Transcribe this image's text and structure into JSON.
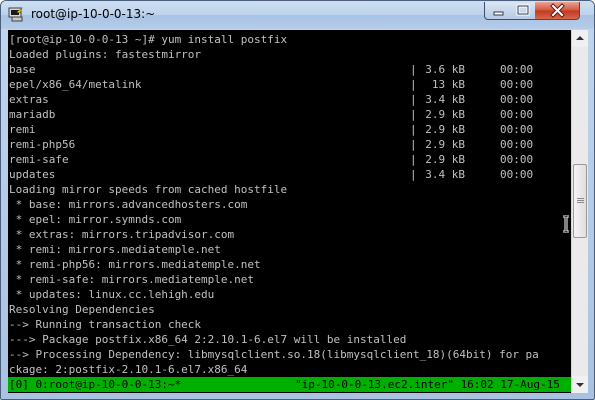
{
  "window": {
    "title": "root@ip-10-0-0-13:~",
    "app_icon": "putty-terminal-icon",
    "controls": {
      "minimize_icon": "minimize-icon",
      "maximize_icon": "maximize-icon",
      "close_icon": "close-icon"
    }
  },
  "terminal": {
    "lines_before": [
      "[root@ip-10-0-0-13 ~]# yum install postfix",
      "Loaded plugins: fastestmirror"
    ],
    "repos": [
      {
        "name": "base",
        "size": "3.6 kB",
        "time": "00:00"
      },
      {
        "name": "epel/x86_64/metalink",
        "size": "13 kB",
        "time": "00:00"
      },
      {
        "name": "extras",
        "size": "3.4 kB",
        "time": "00:00"
      },
      {
        "name": "mariadb",
        "size": "2.9 kB",
        "time": "00:00"
      },
      {
        "name": "remi",
        "size": "2.9 kB",
        "time": "00:00"
      },
      {
        "name": "remi-php56",
        "size": "2.9 kB",
        "time": "00:00"
      },
      {
        "name": "remi-safe",
        "size": "2.9 kB",
        "time": "00:00"
      },
      {
        "name": "updates",
        "size": "3.4 kB",
        "time": "00:00"
      }
    ],
    "lines_after": [
      "Loading mirror speeds from cached hostfile",
      " * base: mirrors.advancedhosters.com",
      " * epel: mirror.symnds.com",
      " * extras: mirrors.tripadvisor.com",
      " * remi: mirrors.mediatemple.net",
      " * remi-php56: mirrors.mediatemple.net",
      " * remi-safe: mirrors.mediatemple.net",
      " * updates: linux.cc.lehigh.edu",
      "Resolving Dependencies",
      "--> Running transaction check",
      "---> Package postfix.x86_64 2:2.10.1-6.el7 will be installed",
      "--> Processing Dependency: libmysqlclient.so.18(libmysqlclient_18)(64bit) for pa",
      "ckage: 2:postfix-2.10.1-6.el7.x86_64"
    ],
    "separator": "|",
    "text_color": "#c0c0c0",
    "background": "#000000"
  },
  "statusbar": {
    "left": "[0] 0:root@ip-10-0-0-13:~*",
    "right": "\"ip-10-0-0-13.ec2.inter\" 16:02 17-Aug-15",
    "background": "#00b000"
  },
  "scrollbar": {
    "up_icon": "scroll-up-arrow-icon",
    "down_icon": "scroll-down-arrow-icon"
  }
}
